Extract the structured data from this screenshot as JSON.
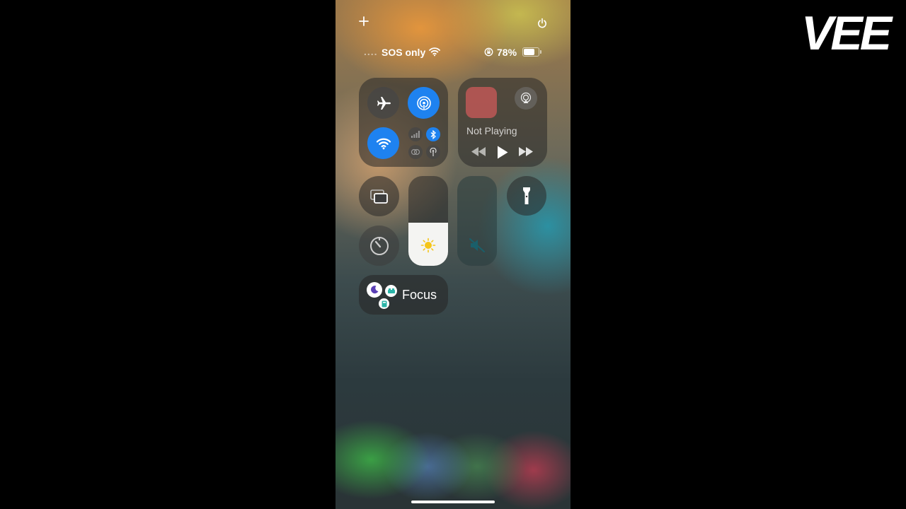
{
  "status_bar": {
    "signal": "....",
    "carrier": "SOS only",
    "battery_percent": "78%",
    "battery_level": 0.78
  },
  "media": {
    "now_playing": "Not Playing"
  },
  "focus": {
    "label": "Focus"
  },
  "brightness_level": 0.48,
  "volume_level": 0.0,
  "watermark": "VEE",
  "colors": {
    "accent_blue": "#1e82f0",
    "tile_bg": "rgba(40,40,40,0.55)"
  },
  "icons": [
    "add-icon",
    "power-icon",
    "wifi-status-icon",
    "orientation-lock-icon",
    "battery-icon",
    "airplane-icon",
    "airdrop-icon",
    "wifi-icon",
    "cellular-icon",
    "bluetooth-icon",
    "hotspot-icon",
    "vpn-icon",
    "airplay-icon",
    "rewind-icon",
    "play-icon",
    "fast-forward-icon",
    "screen-mirroring-icon",
    "flashlight-icon",
    "timer-icon",
    "sun-icon",
    "mute-icon",
    "moon-icon",
    "bed-icon",
    "id-icon"
  ]
}
